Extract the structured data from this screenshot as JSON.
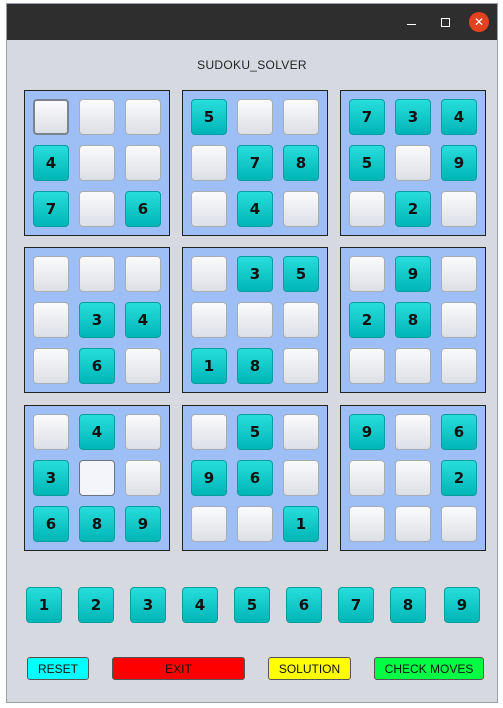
{
  "window": {
    "close_glyph": "✕"
  },
  "app": {
    "title": "SUDOKU_SOLVER"
  },
  "boxes": [
    [
      "",
      "",
      "",
      "4",
      "",
      "",
      "7",
      "",
      "6"
    ],
    [
      "5",
      "",
      "",
      "",
      "7",
      "8",
      "",
      "4",
      ""
    ],
    [
      "7",
      "3",
      "4",
      "5",
      "",
      "9",
      "",
      "2",
      ""
    ],
    [
      "",
      "",
      "",
      "",
      "3",
      "4",
      "",
      "6",
      ""
    ],
    [
      "",
      "3",
      "5",
      "",
      "",
      "",
      "1",
      "8",
      ""
    ],
    [
      "",
      "9",
      "",
      "2",
      "8",
      "",
      "",
      "",
      ""
    ],
    [
      "",
      "4",
      "",
      "3",
      "",
      "",
      "6",
      "8",
      "9"
    ],
    [
      "",
      "5",
      "",
      "9",
      "6",
      "",
      "",
      "",
      "1"
    ],
    [
      "9",
      "",
      "6",
      "",
      "",
      "2",
      "",
      "",
      ""
    ]
  ],
  "number_buttons": [
    "1",
    "2",
    "3",
    "4",
    "5",
    "6",
    "7",
    "8",
    "9"
  ],
  "actions": {
    "reset": {
      "label": "RESET",
      "color": "#00ffff"
    },
    "exit": {
      "label": "EXIT",
      "color": "#ff0000"
    },
    "solution": {
      "label": "SOLUTION",
      "color": "#ffff00"
    },
    "check_moves": {
      "label": "CHECK MOVES",
      "color": "#00ff44"
    }
  },
  "colors": {
    "box_fill": "#9dbff5",
    "filled_cell": "#00c8c8",
    "window_bg": "#d6d9df",
    "titlebar": "#2e2e2e"
  }
}
